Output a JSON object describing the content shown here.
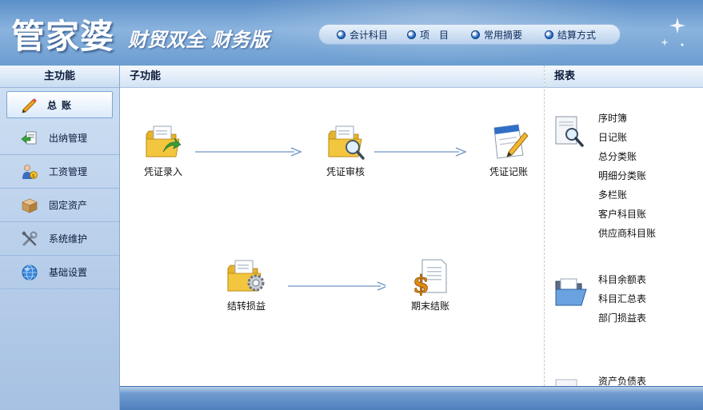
{
  "header": {
    "logo_main": "管家婆",
    "logo_sub": "财贸双全 财务版",
    "nav": [
      {
        "label": "会计科目",
        "icon": "radio-dot-icon"
      },
      {
        "label": "项　目",
        "icon": "radio-dot-icon"
      },
      {
        "label": "常用摘要",
        "icon": "radio-dot-icon"
      },
      {
        "label": "结算方式",
        "icon": "radio-dot-icon"
      }
    ]
  },
  "sidebar": {
    "title": "主功能",
    "items": [
      {
        "label": "总账",
        "icon": "pencil-icon",
        "active": true
      },
      {
        "label": "出纳管理",
        "icon": "cashier-icon"
      },
      {
        "label": "工资管理",
        "icon": "salary-icon"
      },
      {
        "label": "固定资产",
        "icon": "box-icon"
      },
      {
        "label": "系统维护",
        "icon": "tools-icon"
      },
      {
        "label": "基础设置",
        "icon": "globe-icon"
      }
    ]
  },
  "main": {
    "title": "子功能",
    "flow": [
      {
        "label": "凭证录入",
        "icon": "folder-arrow-icon"
      },
      {
        "label": "凭证审核",
        "icon": "folder-search-icon"
      },
      {
        "label": "凭证记账",
        "icon": "document-pencil-icon"
      },
      {
        "label": "结转损益",
        "icon": "folder-gear-icon"
      },
      {
        "label": "期末结账",
        "icon": "dollar-document-icon"
      }
    ]
  },
  "reports": {
    "title": "报表",
    "group1": [
      "序时簿",
      "日记账",
      "总分类账",
      "明细分类账",
      "多栏账",
      "客户科目账",
      "供应商科目账"
    ],
    "group2": [
      "科目余额表",
      "科目汇总表",
      "部门损益表"
    ],
    "group3": [
      "资产负债表"
    ]
  },
  "colors": {
    "header_blue": "#6b9dd0",
    "sidebar_blue": "#b6cde9",
    "arrow_blue": "#6f95c6"
  }
}
